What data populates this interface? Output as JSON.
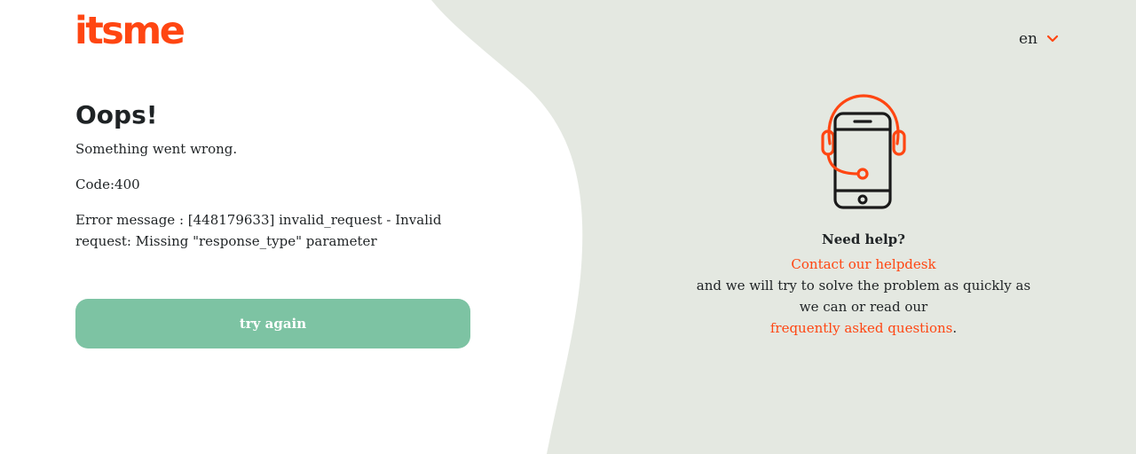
{
  "brand": {
    "logo_text": "itsme",
    "accent_color": "#ff4612",
    "button_color": "#7dc3a3",
    "panel_color": "#e4e8e1"
  },
  "language": {
    "selected": "en",
    "icon": "chevron-down-icon"
  },
  "error": {
    "title": "Oops!",
    "subtitle": "Something went wrong.",
    "code_label": "Code:",
    "code_value": "400",
    "message": "Error message : [448179633] invalid_request - Invalid request: Missing \"response_type\" parameter"
  },
  "actions": {
    "retry_label": "try again"
  },
  "help": {
    "icon": "phone-headset-icon",
    "title": "Need help?",
    "contact_link": "Contact our helpdesk",
    "text_middle": "and we will try to solve the problem as quickly as we can or read our",
    "faq_link": "frequently asked questions",
    "text_end": "."
  }
}
